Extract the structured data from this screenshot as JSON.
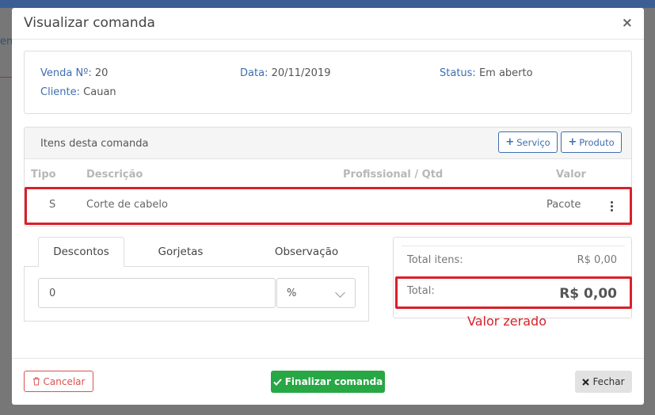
{
  "background": {
    "tab_fragment": "en"
  },
  "modal": {
    "title": "Visualizar comanda",
    "close_glyph": "×"
  },
  "sale_info": {
    "sale_number_label": "Venda Nº:",
    "sale_number": "20",
    "date_label": "Data:",
    "date": "20/11/2019",
    "status_label": "Status:",
    "status": "Em aberto",
    "client_label": "Cliente:",
    "client": "Cauan"
  },
  "items": {
    "title": "Itens desta comanda",
    "add_service_label": "Serviço",
    "add_product_label": "Produto",
    "columns": [
      "Tipo",
      "Descrição",
      "Profissional / Qtd",
      "Valor"
    ],
    "rows": [
      {
        "type": "S",
        "description": "Corte de cabelo",
        "professional": "",
        "value": "Pacote"
      }
    ]
  },
  "tabs": {
    "labels": [
      "Descontos",
      "Gorjetas",
      "Observação"
    ],
    "active": "Descontos",
    "discount_value": "0",
    "discount_unit": "%"
  },
  "totals": {
    "items_label": "Total itens:",
    "items_value": "R$ 0,00",
    "total_label": "Total:",
    "total_value": "R$ 0,00"
  },
  "annotation": "Valor zerado",
  "footer": {
    "cancel_label": "Cancelar",
    "finish_label": "Finalizar comanda",
    "close_label": "Fechar"
  },
  "icons": {
    "plus": "plus-icon",
    "trash": "trash-icon",
    "check": "check-icon",
    "times": "times-icon",
    "kebab": "kebab-menu-icon"
  },
  "colors": {
    "accent_blue": "#3e6eb0",
    "danger": "#d9534f",
    "success": "#28a745",
    "highlight_red": "#d9202a"
  }
}
